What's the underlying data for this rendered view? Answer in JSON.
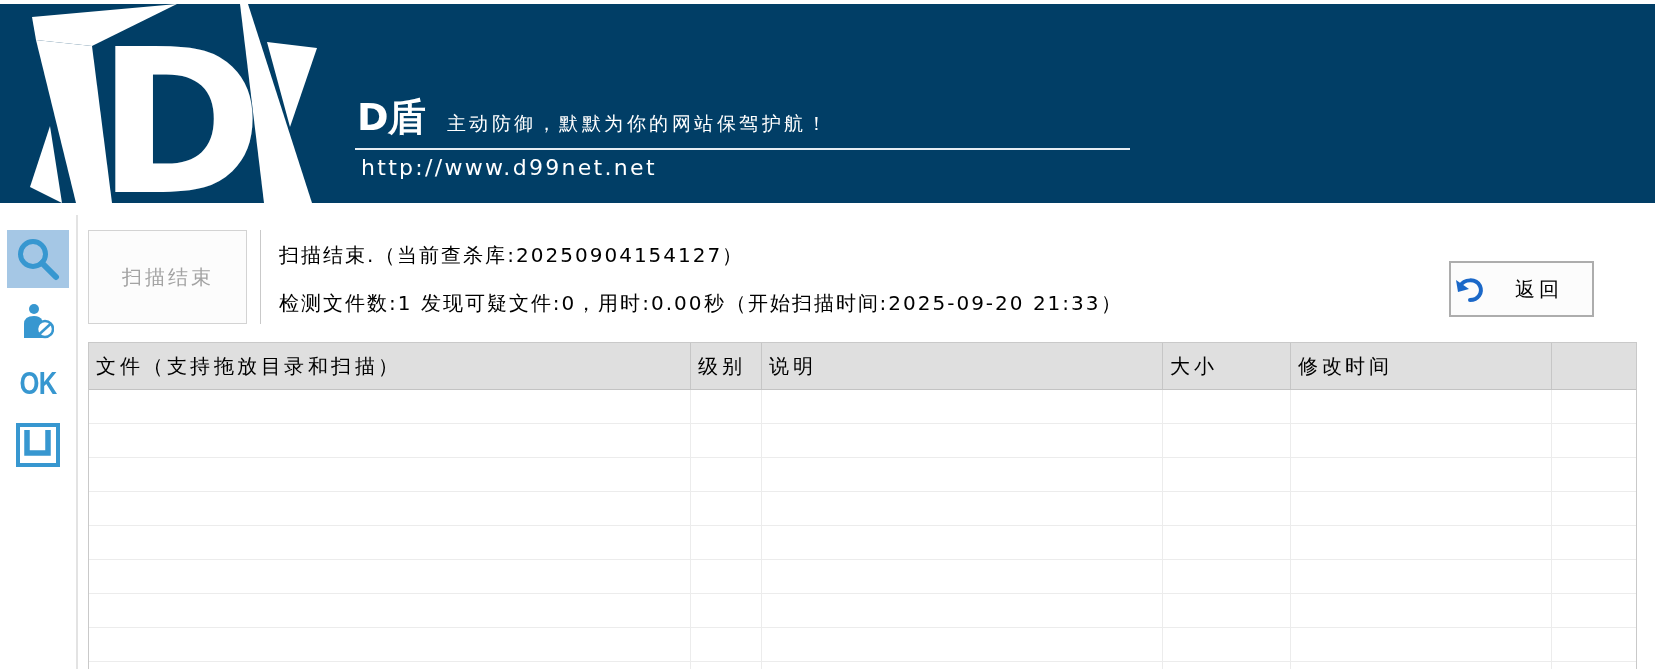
{
  "header": {
    "logo_letter": "D",
    "brand": "D盾",
    "slogan": "主动防御，默默为你的网站保驾护航！",
    "url": "http://www.d99net.net"
  },
  "sidebar": {
    "items": [
      {
        "kind": "search",
        "selected": true
      },
      {
        "kind": "user",
        "selected": false
      },
      {
        "kind": "label",
        "label": "OK",
        "selected": false
      },
      {
        "kind": "frame",
        "selected": false
      }
    ]
  },
  "scan_button": {
    "label": "扫描结束",
    "disabled": true
  },
  "status": {
    "lines": [
      "扫描结束.（当前查杀库:20250904154127）",
      "检测文件数:1 发现可疑文件:0，用时:0.00秒（开始扫描时间:2025-09-20 21:33）"
    ]
  },
  "return_button": {
    "label": "返回"
  },
  "table": {
    "columns": [
      "文件（支持拖放目录和扫描）",
      "级别",
      "说明",
      "大小",
      "修改时间"
    ]
  }
}
